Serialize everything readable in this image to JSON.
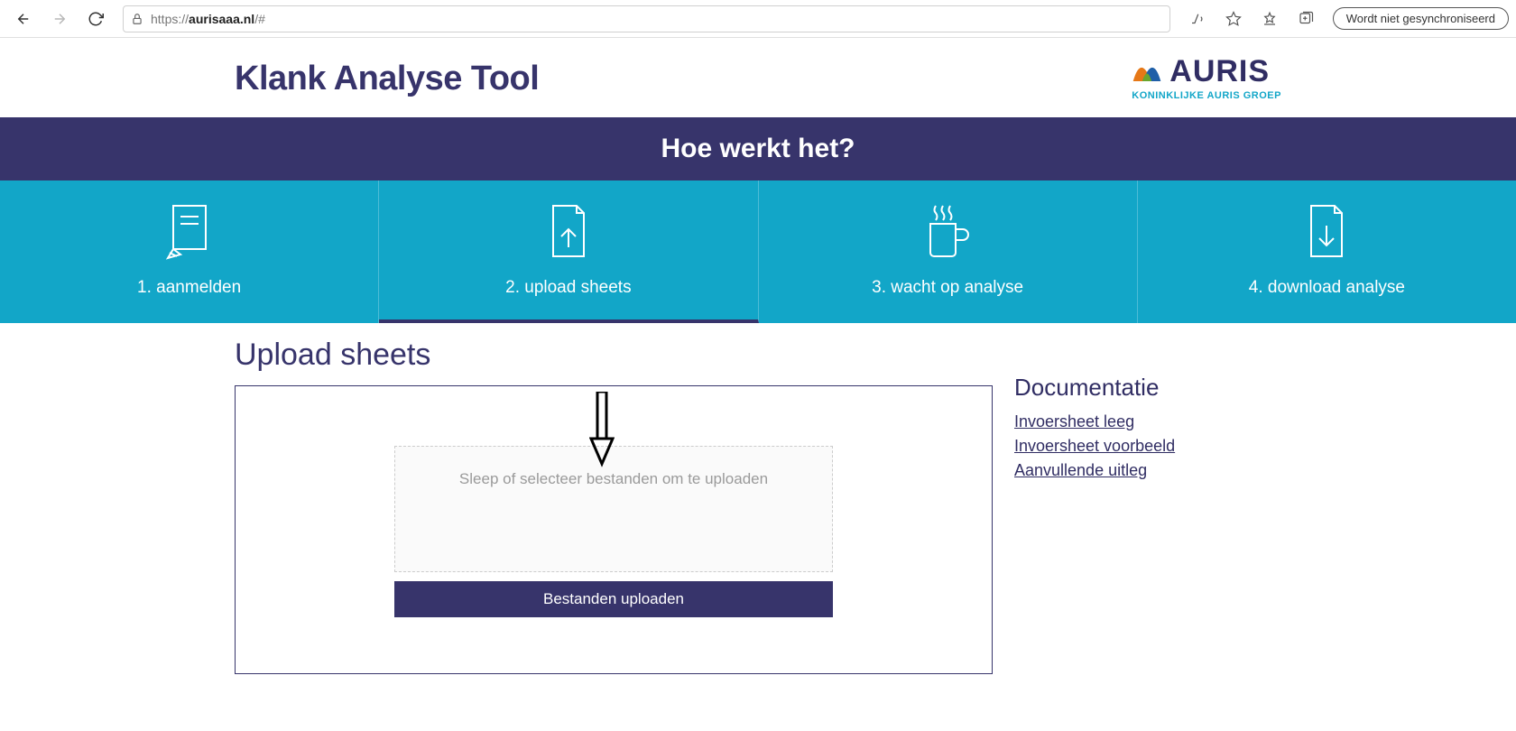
{
  "browser": {
    "url_protocol": "https://",
    "url_host": "aurisaaa.nl",
    "url_path": "/#",
    "sync_status": "Wordt niet gesynchroniseerd"
  },
  "header": {
    "page_title": "Klank Analyse Tool",
    "logo_word": "AURIS",
    "logo_sub": "KONINKLIJKE AURIS GROEP"
  },
  "howto_title": "Hoe werkt het?",
  "steps": [
    {
      "label": "1. aanmelden"
    },
    {
      "label": "2. upload sheets"
    },
    {
      "label": "3. wacht op analyse"
    },
    {
      "label": "4. download analyse"
    }
  ],
  "upload": {
    "section_title": "Upload sheets",
    "dropzone_text": "Sleep of selecteer bestanden om te uploaden",
    "button_label": "Bestanden uploaden"
  },
  "docs": {
    "title": "Documentatie",
    "links": [
      "Invoersheet leeg",
      "Invoersheet voorbeeld",
      "Aanvullende uitleg"
    ]
  }
}
